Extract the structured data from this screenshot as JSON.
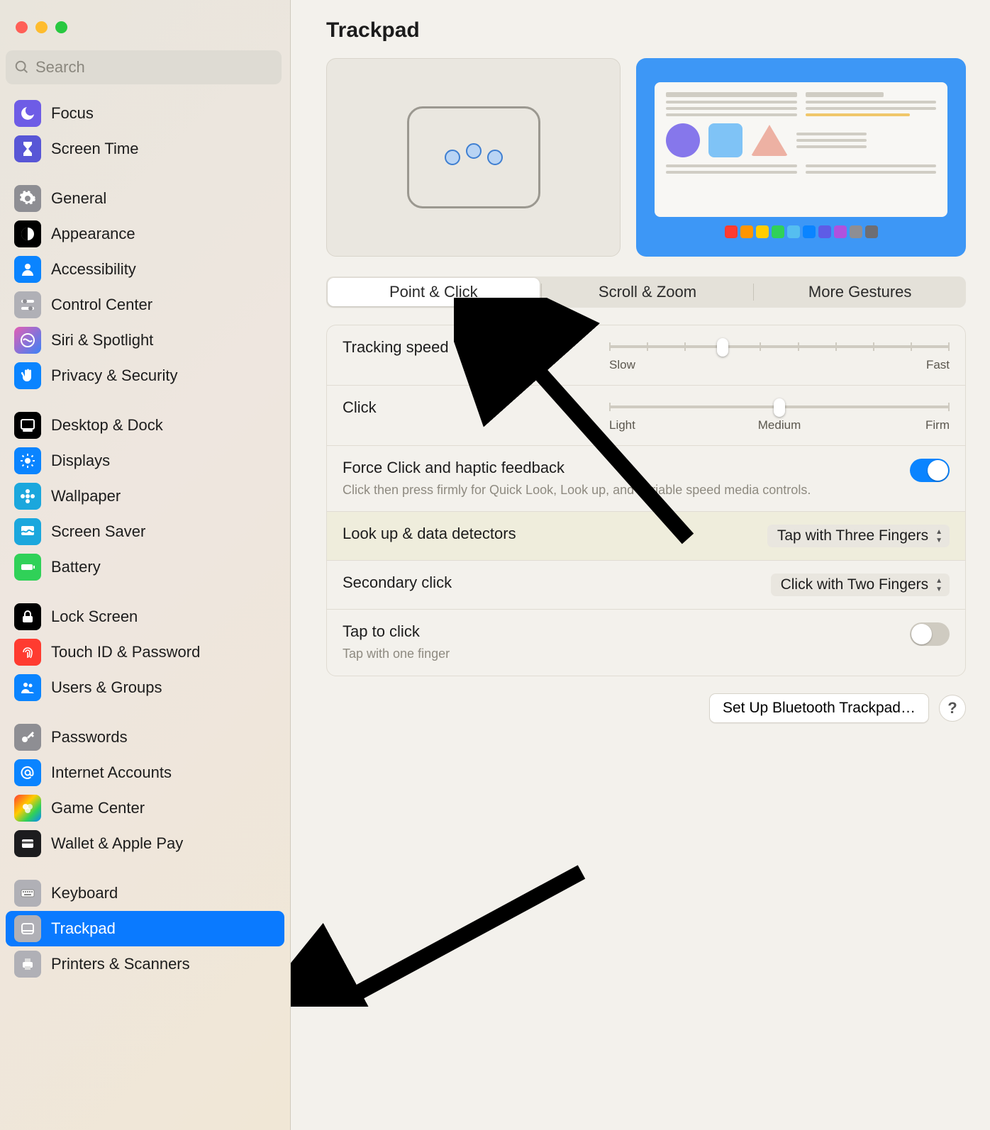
{
  "window": {
    "title": "Trackpad"
  },
  "sidebar": {
    "search_placeholder": "Search",
    "items": [
      {
        "label": "Focus",
        "icon": "moon",
        "bg": "bg-purple"
      },
      {
        "label": "Screen Time",
        "icon": "hourglass",
        "bg": "bg-indigo"
      },
      {
        "gap": true
      },
      {
        "label": "General",
        "icon": "gear",
        "bg": "bg-gray"
      },
      {
        "label": "Appearance",
        "icon": "contrast",
        "bg": "bg-black"
      },
      {
        "label": "Accessibility",
        "icon": "person",
        "bg": "bg-blue"
      },
      {
        "label": "Control Center",
        "icon": "switches",
        "bg": "bg-lgray"
      },
      {
        "label": "Siri & Spotlight",
        "icon": "siri",
        "bg": "bg-siri"
      },
      {
        "label": "Privacy & Security",
        "icon": "hand",
        "bg": "bg-blue"
      },
      {
        "gap": true
      },
      {
        "label": "Desktop & Dock",
        "icon": "dock",
        "bg": "bg-black"
      },
      {
        "label": "Displays",
        "icon": "sun",
        "bg": "bg-blue"
      },
      {
        "label": "Wallpaper",
        "icon": "flower",
        "bg": "bg-cyan"
      },
      {
        "label": "Screen Saver",
        "icon": "screensaver",
        "bg": "bg-cyan"
      },
      {
        "label": "Battery",
        "icon": "battery",
        "bg": "bg-green"
      },
      {
        "gap": true
      },
      {
        "label": "Lock Screen",
        "icon": "lock",
        "bg": "bg-black"
      },
      {
        "label": "Touch ID & Password",
        "icon": "fingerprint",
        "bg": "bg-red"
      },
      {
        "label": "Users & Groups",
        "icon": "users",
        "bg": "bg-blue"
      },
      {
        "gap": true
      },
      {
        "label": "Passwords",
        "icon": "key",
        "bg": "bg-mgray"
      },
      {
        "label": "Internet Accounts",
        "icon": "at",
        "bg": "bg-blue"
      },
      {
        "label": "Game Center",
        "icon": "gamecenter",
        "bg": "bg-gc"
      },
      {
        "label": "Wallet & Apple Pay",
        "icon": "wallet",
        "bg": "bg-dark"
      },
      {
        "gap": true
      },
      {
        "label": "Keyboard",
        "icon": "keyboard",
        "bg": "bg-lgray"
      },
      {
        "label": "Trackpad",
        "icon": "trackpad",
        "bg": "bg-lgray",
        "selected": true
      },
      {
        "label": "Printers & Scanners",
        "icon": "printer",
        "bg": "bg-lgray"
      }
    ]
  },
  "tabs": [
    {
      "label": "Point & Click",
      "active": true
    },
    {
      "label": "Scroll & Zoom",
      "active": false
    },
    {
      "label": "More Gestures",
      "active": false
    }
  ],
  "settings": {
    "tracking_speed": {
      "title": "Tracking speed",
      "min_label": "Slow",
      "max_label": "Fast",
      "ticks": 10,
      "value_index": 3
    },
    "click": {
      "title": "Click",
      "left_label": "Light",
      "mid_label": "Medium",
      "right_label": "Firm",
      "ticks": 3,
      "value_index": 1
    },
    "force_click": {
      "title": "Force Click and haptic feedback",
      "sub": "Click then press firmly for Quick Look, Look up, and variable speed media controls.",
      "on": true
    },
    "lookup": {
      "title": "Look up & data detectors",
      "value": "Tap with Three Fingers"
    },
    "secondary_click": {
      "title": "Secondary click",
      "value": "Click with Two Fingers"
    },
    "tap_to_click": {
      "title": "Tap to click",
      "sub": "Tap with one finger",
      "on": false
    }
  },
  "footer": {
    "bluetooth_button": "Set Up Bluetooth Trackpad…",
    "help_label": "?"
  },
  "dock_colors": [
    "#ff3b30",
    "#ff9500",
    "#ffcc00",
    "#30d158",
    "#55bef0",
    "#0a84ff",
    "#5e5ce6",
    "#af52de",
    "#8e8e93",
    "#6e6e73"
  ]
}
